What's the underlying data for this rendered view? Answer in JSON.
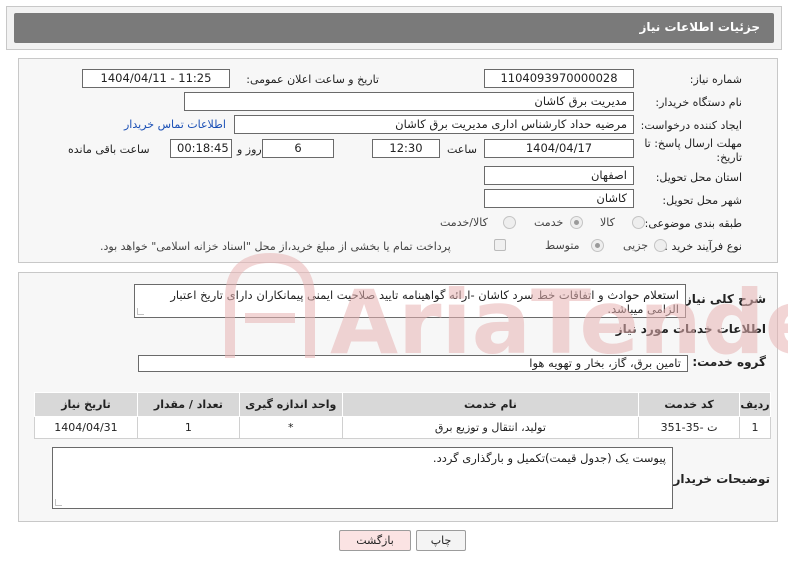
{
  "header": {
    "title": "جزئیات اطلاعات نیاز"
  },
  "form": {
    "need_number_label": "شماره نیاز:",
    "need_number": "1104093970000028",
    "announce_label": "تاریخ و ساعت اعلان عمومی:",
    "announce_value": "1404/04/11 - 11:25",
    "buyer_label": "نام دستگاه خریدار:",
    "buyer_value": "مدیریت برق کاشان",
    "creator_label": "ایجاد کننده درخواست:",
    "creator_value": "مرضیه حداد کارشناس اداری مدیریت برق کاشان",
    "contact_link": "اطلاعات تماس خریدار",
    "deadline_label_1": "مهلت ارسال پاسخ: تا",
    "deadline_label_2": "تاریخ:",
    "deadline_date": "1404/04/17",
    "hour_label": "ساعت",
    "deadline_time": "12:30",
    "days_value": "6",
    "days_label": "روز و",
    "remaining_time": "00:18:45",
    "remaining_label": "ساعت باقی مانده",
    "province_label": "استان محل تحویل:",
    "province_value": "اصفهان",
    "city_label": "شهر محل تحویل:",
    "city_value": "کاشان",
    "category_label": "طبقه بندی موضوعی:",
    "category_options": [
      "کالا",
      "خدمت",
      "کالا/خدمت"
    ],
    "category_selected": "خدمت",
    "purchase_label": "نوع فرآیند خرید :",
    "purchase_options": [
      "جزیی",
      "متوسط"
    ],
    "purchase_selected": "متوسط",
    "payment_note": "پرداخت تمام یا بخشی از مبلغ خرید،از محل \"اسناد خزانه اسلامی\" خواهد بود."
  },
  "details": {
    "summary_label": "شرح کلی نیاز:",
    "summary_text": "استعلام حوادث و اتفاقات خط سرد کاشان -ارائه گواهینامه تایید صلاحیت ایمنی پیمانکاران دارای تاریخ اعتبار الزامی میباشد.",
    "services_title": "اطلاعات خدمات مورد نیاز",
    "service_group_label": "گروه خدمت:",
    "service_group_value": "تامین برق، گاز، بخار و تهویه هوا",
    "table_headers": [
      "ردیف",
      "کد خدمت",
      "نام خدمت",
      "واحد اندازه گیری",
      "تعداد / مقدار",
      "تاریخ نیاز"
    ],
    "table_rows": [
      [
        "1",
        "ت -35-351",
        "تولید، انتقال و توزیع برق",
        "*",
        "1",
        "1404/04/31"
      ]
    ],
    "buyer_notes_label": "توضیحات خریدار:",
    "buyer_notes_text": "پیوست یک (جدول قیمت)تکمیل و بارگذاری گردد."
  },
  "buttons": {
    "print": "چاپ",
    "back": "بازگشت"
  },
  "watermark": {
    "text": "AriaTender.net"
  },
  "colors": {
    "header_bg": "#7a7a7a",
    "link": "#1a4fb5",
    "back_button": "#fbe3e3",
    "watermark": "#e8b4b4"
  }
}
